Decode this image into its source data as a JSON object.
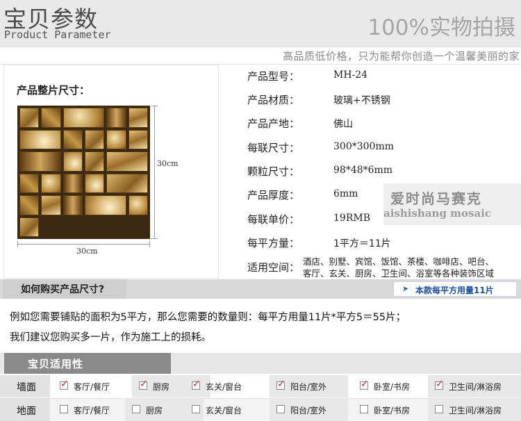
{
  "header": {
    "title_cn": "宝贝参数",
    "title_en": "Product Parameter",
    "right_text": "100%实物拍摄"
  },
  "slogan": "高品质低价格，只为能帮你创造一个温馨美丽的家",
  "tile": {
    "title": "产品整片尺寸：",
    "height_label": "30cm",
    "width_label": "30cm"
  },
  "specs": [
    {
      "label": "产品型号：",
      "value": "MH-24"
    },
    {
      "label": "产品材质：",
      "value": "玻璃+不锈钢"
    },
    {
      "label": "产品产地：",
      "value": "佛山"
    },
    {
      "label": "每联尺寸：",
      "value": "300*300mm"
    },
    {
      "label": "颗粒尺寸：",
      "value": "98*48*6mm"
    },
    {
      "label": "产品厚度：",
      "value": "6mm"
    },
    {
      "label": "每联单价：",
      "value": "19RMB"
    },
    {
      "label": "每平方量：",
      "value": "1平方＝11片"
    }
  ],
  "usage": {
    "label": "适用空间：",
    "line1": "酒店、别墅、宾馆、饭馆、茶楼、咖啡店、吧台、",
    "line2": "客厅、玄关、厨房、卫生间、浴室等各种装饰区域"
  },
  "watermark": {
    "cn": "爱时尚马赛克",
    "en": "aishishang mosaic"
  },
  "how_to_buy": {
    "title": "如何购买产品尺寸?",
    "note": "本款每平方用量11片",
    "line1": "例如您需要铺贴的面积为5平方，那么您需要的数量则：每平方用量11片*平方5＝55片；",
    "line2": "我们建议您购买多一片，作为施工上的损耗。"
  },
  "suitability": {
    "title": "宝贝适用性",
    "rows": [
      {
        "label": "墙面",
        "items": [
          {
            "text": "客厅/餐厅",
            "checked": true
          },
          {
            "text": "厨房",
            "checked": true
          },
          {
            "text": "玄关/窗台",
            "checked": true
          },
          {
            "text": "阳台/室外",
            "checked": true
          },
          {
            "text": "卧室/书房",
            "checked": true
          },
          {
            "text": "卫生间/淋浴房",
            "checked": true
          }
        ]
      },
      {
        "label": "地面",
        "items": [
          {
            "text": "客厅/餐厅",
            "checked": false
          },
          {
            "text": "厨房",
            "checked": false
          },
          {
            "text": "玄关/窗台",
            "checked": false
          },
          {
            "text": "阳台/室外",
            "checked": false
          },
          {
            "text": "卧室/书房",
            "checked": false
          },
          {
            "text": "卫生间/淋浴房",
            "checked": false
          }
        ]
      }
    ]
  },
  "colors": {
    "accent_check": "#dd2222",
    "note_text": "#1a4fa0",
    "suit_tab": "#8a8a8a"
  }
}
